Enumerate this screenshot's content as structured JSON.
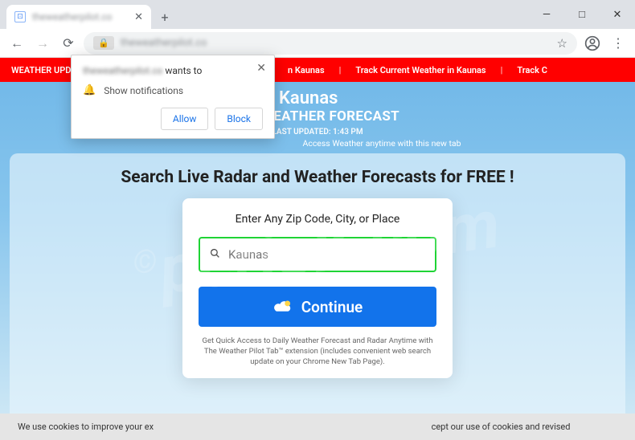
{
  "browser": {
    "tab_title": "theweatherpilot.co",
    "url_text": "theweatherpilot.co",
    "window": {
      "minimize": "—",
      "maximize": "□",
      "close": "✕"
    }
  },
  "notification": {
    "site": "theweatherpilot.co",
    "wants_to": "wants to",
    "show": "Show notifications",
    "allow": "Allow",
    "block": "Block"
  },
  "redbar": {
    "label": "WEATHER UPDATE",
    "item1": "n Kaunas",
    "item2": "Track Current Weather in Kaunas",
    "item3": "Track C"
  },
  "hero": {
    "city": "s, Kaunas",
    "forecast": "WEATHER FORECAST",
    "updated": "LAST UPDATED: 1:43 PM",
    "access": "Access Weather anytime with this new tab"
  },
  "panel": {
    "heading": "Search Live Radar and Weather Forecasts for FREE !"
  },
  "card": {
    "prompt": "Enter Any Zip Code, City, or Place",
    "input_value": "Kaunas",
    "continue": "Continue",
    "disclaimer": "Get Quick Access to Daily Weather Forecast and Radar Anytime with The Weather Pilot Tab™ extension (includes convenient web search update on your Chrome New Tab Page)."
  },
  "cookies": {
    "left": "We use cookies to improve your ex",
    "right": "cept our use of cookies and revised"
  },
  "watermark": "pcrisk.com"
}
